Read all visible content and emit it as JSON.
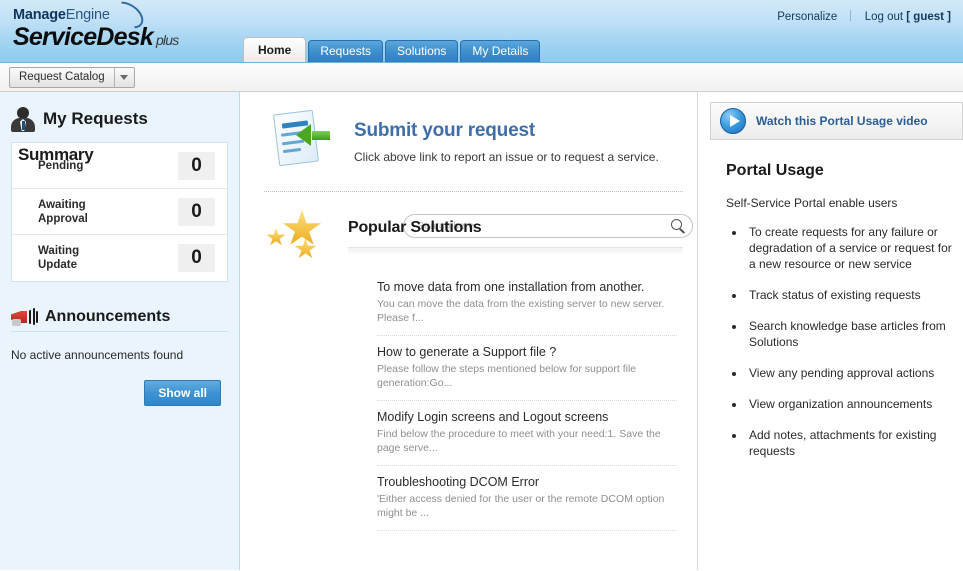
{
  "header": {
    "logo_top_bold": "Manage",
    "logo_top_light": "Engine",
    "logo_main": "ServiceDesk",
    "logo_plus": "plus",
    "personalize": "Personalize",
    "logout": "Log out",
    "user": "[ guest ]"
  },
  "tabs": [
    {
      "label": "Home",
      "active": true
    },
    {
      "label": "Requests",
      "active": false
    },
    {
      "label": "Solutions",
      "active": false
    },
    {
      "label": "My Details",
      "active": false
    }
  ],
  "subbar": {
    "catalog_label": "Request Catalog"
  },
  "sidebar": {
    "my_requests_title": "My Requests",
    "summary_title": "Summary",
    "summary_rows": [
      {
        "label": "Pending",
        "count": "0"
      },
      {
        "label": "Awaiting\nApproval",
        "count": "0"
      },
      {
        "label": "Waiting\nUpdate",
        "count": "0"
      }
    ],
    "announcements_title": "Announcements",
    "announcements_empty": "No active announcements found",
    "show_all_label": "Show all"
  },
  "center": {
    "submit_title": "Submit your request",
    "submit_subtitle": "Click above link to report an issue or to request a service.",
    "popular_solutions_title": "Popular Solutions",
    "search_placeholder": "Search here",
    "search_value": "",
    "solutions": [
      {
        "title": "To move data from one installation from another.",
        "desc": "You can move the data from the existing server to new server. Please f..."
      },
      {
        "title": "How to generate a Support file ?",
        "desc": "Please follow the steps mentioned below for support file generation:Go..."
      },
      {
        "title": "Modify Login screens and Logout screens",
        "desc": "Find below the procedure to meet with your need:1. Save the page serve..."
      },
      {
        "title": "Troubleshooting DCOM Error",
        "desc": "'Either access denied for the user or the remote DCOM option might be ..."
      }
    ]
  },
  "right": {
    "video_link": "Watch this Portal Usage video",
    "portal_title": "Portal Usage",
    "portal_intro": "Self-Service Portal enable users",
    "portal_items": [
      "To create requests for any failure or degradation of a service or request for a new resource or new service",
      "Track status of existing requests",
      "Search knowledge base articles from Solutions",
      "View any pending approval actions",
      "View organization announcements",
      "Add notes, attachments for existing requests"
    ]
  },
  "colors": {
    "header_top": "#d3e9f9",
    "header_bottom": "#8ecbf0",
    "tab_blue": "#3e8fcd",
    "sidebar_bg": "#e9f4fc",
    "link_blue": "#3f6ea8",
    "button_blue": "#3e93d3"
  }
}
